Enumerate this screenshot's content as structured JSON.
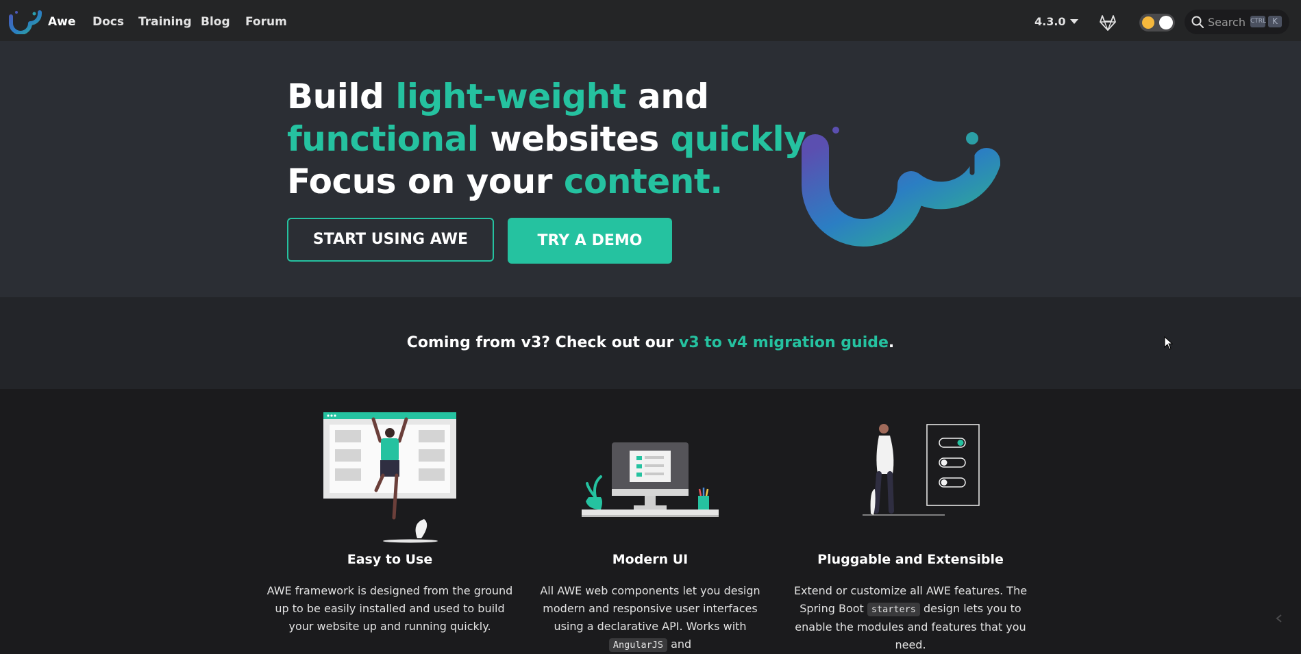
{
  "nav": {
    "brand": "Awe",
    "links": [
      "Docs",
      "Training",
      "Blog",
      "Forum"
    ],
    "version": "4.3.0",
    "search_placeholder": "Search",
    "search_kbd": [
      "CTRL",
      "K"
    ],
    "icons": {
      "logo": "awe-logo-icon",
      "gitlab": "gitlab-icon",
      "theme": "theme-toggle-icon",
      "search": "search-icon"
    }
  },
  "hero": {
    "line1": {
      "a": "Build ",
      "b": "light-weight",
      "c": " and"
    },
    "line2": {
      "a": "functional",
      "b": " websites ",
      "c": "quickly",
      "d": "."
    },
    "line3": {
      "a": "Focus on your ",
      "b": "content."
    },
    "button_primary": "START USING AWE",
    "button_secondary": "TRY A DEMO"
  },
  "banner": {
    "prefix": "Coming from v3? Check out our ",
    "link": "v3 to v4 migration guide",
    "suffix": "."
  },
  "features": [
    {
      "title": "Easy to Use",
      "text": "AWE framework is designed from the ground up to be easily installed and used to build your website up and running quickly."
    },
    {
      "title": "Modern UI",
      "text_a": "All AWE web components let you design modern and responsive user interfaces using a declarative API. Works with ",
      "code": "AngularJS",
      "text_b": " and"
    },
    {
      "title": "Pluggable and Extensible",
      "text_a": "Extend or customize all AWE features. The Spring Boot ",
      "code": "starters",
      "text_b": " design lets you to enable the modules and features that you need."
    }
  ],
  "colors": {
    "accent": "#25c2a0",
    "nav_bg": "#242526",
    "hero_bg": "#2b2e34",
    "banner_bg": "#232529",
    "page_bg": "#1b1b1d"
  }
}
